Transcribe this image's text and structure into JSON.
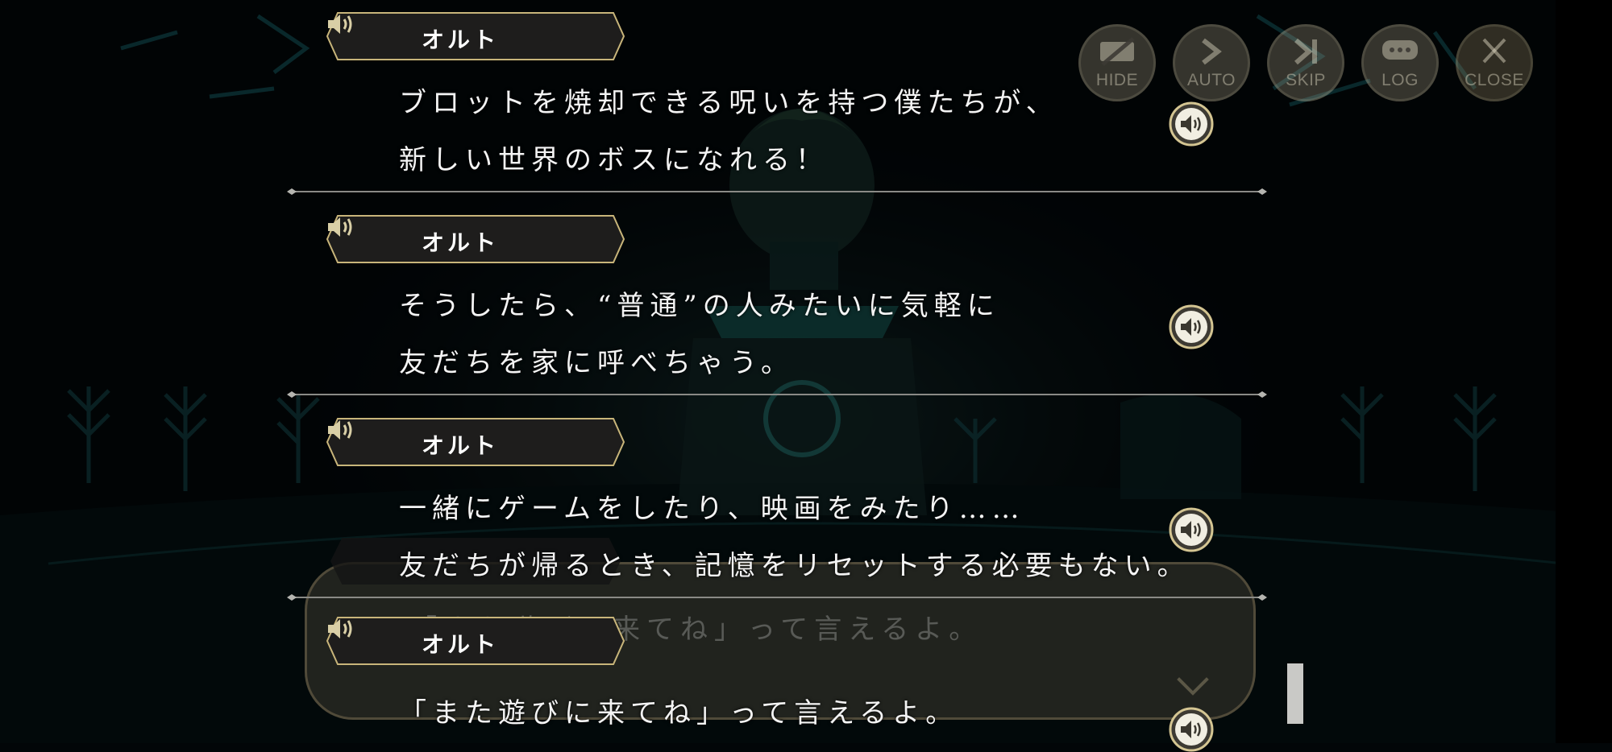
{
  "controls": {
    "hide": "HIDE",
    "auto": "AUTO",
    "skip": "SKIP",
    "log": "LOG",
    "close": "CLOSE"
  },
  "background_dialog": {
    "text": "「また遊びに来てね」って言えるよ。"
  },
  "log_entries": [
    {
      "speaker": "オルト",
      "lines": [
        "ブロットを焼却できる呪いを持つ僕たちが、",
        "新しい世界のボスになれる！"
      ]
    },
    {
      "speaker": "オルト",
      "lines": [
        "そうしたら、“普通”の人みたいに気軽に",
        "友だちを家に呼べちゃう。"
      ]
    },
    {
      "speaker": "オルト",
      "lines": [
        "一緒にゲームをしたり、映画をみたり……",
        "友だちが帰るとき、記憶をリセットする必要もない。"
      ]
    },
    {
      "speaker": "オルト",
      "lines": [
        "「また遊びに来てね」って言えるよ。"
      ]
    }
  ],
  "icons": {
    "speaker": "speaker-icon",
    "hide": "eye-slash-icon",
    "auto": "chevron-right-icon",
    "skip": "skip-forward-icon",
    "log": "chat-bubble-icon",
    "close": "close-icon"
  },
  "colors": {
    "accent_gold": "#c8b57a",
    "panel_dark": "#1e1d1c",
    "text": "#ffffff"
  }
}
